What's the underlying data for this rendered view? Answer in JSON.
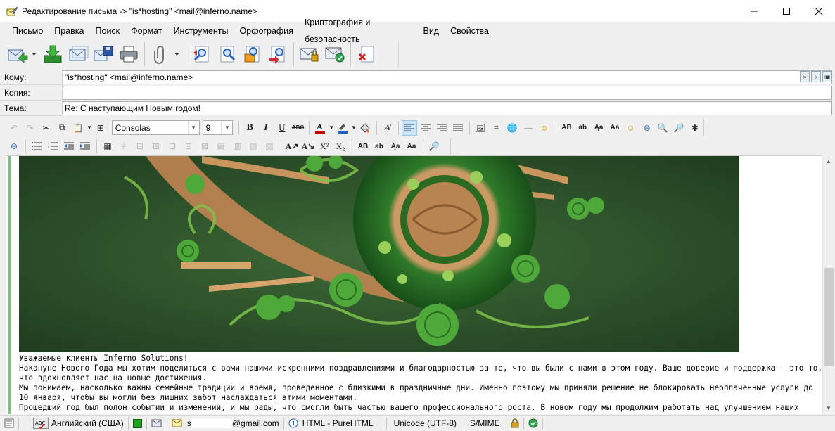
{
  "window": {
    "title": "Редактирование письма -> \"is*hosting\" <mail@inferno.name>",
    "app_icon": "pencil-envelope-icon",
    "controls": [
      "minimize-icon",
      "maximize-icon",
      "close-icon"
    ]
  },
  "menu": {
    "items": [
      "Письмо",
      "Правка",
      "Поиск",
      "Формат",
      "Инструменты",
      "Орфография",
      "Криптография и безопасность",
      "Вид",
      "Свойства"
    ]
  },
  "toolbar": {
    "buttons": [
      "send-icon",
      "receive-icon",
      "queue-icon",
      "save-icon",
      "print-icon",
      "attach-icon",
      "find-icon",
      "find-next-icon",
      "replace-icon",
      "spellcheck-icon",
      "sign-icon",
      "encrypt-icon",
      "cancel-icon"
    ]
  },
  "fields": {
    "to_label": "Кому:",
    "to_value": "\"is*hosting\" <mail@inferno.name>",
    "cc_label": "Копия:",
    "cc_value": "",
    "subject_label": "Тема:",
    "subject_value": "Re: С наступающим Новым годом!"
  },
  "format": {
    "font": "Consolas",
    "size": "9",
    "bold": "B",
    "italic": "I",
    "underline": "U",
    "strike": "ABC",
    "upper": "AB",
    "lower": "ab",
    "title_case": "Aa",
    "sup": "X²",
    "sub": "X₂",
    "colors": {
      "text": "#c00000",
      "highlight": "#1f5fbf",
      "accent": "#0078d7"
    }
  },
  "body": {
    "lines": [
      "Уважаемые клиенты Inferno Solutions!",
      "Накануне Нового Года мы хотим поделиться с вами нашими искренними поздравлениями и благодарностью за то, что вы были с нами в этом году. Ваше доверие и поддержка – это то,",
      "что вдохновляет нас на новые достижения.",
      "Мы понимаем, насколько важны семейные традиции и время, проведенное с близкими в праздничные дни. Именно поэтому мы приняли решение не блокировать неоплаченные услуги до",
      "10 января, чтобы вы могли без лишних забот наслаждаться этими моментами.",
      "Прошедший год был полон событий и изменений, и мы рады, что смогли быть частью вашего профессионального роста. В новом году мы продолжим работать над улучшением наших"
    ]
  },
  "status": {
    "language": "Английский (США)",
    "account": "s",
    "account_domain": "@gmail.com",
    "format": "HTML - PureHTML",
    "encoding": "Unicode (UTF-8)",
    "security": "S/MIME"
  }
}
